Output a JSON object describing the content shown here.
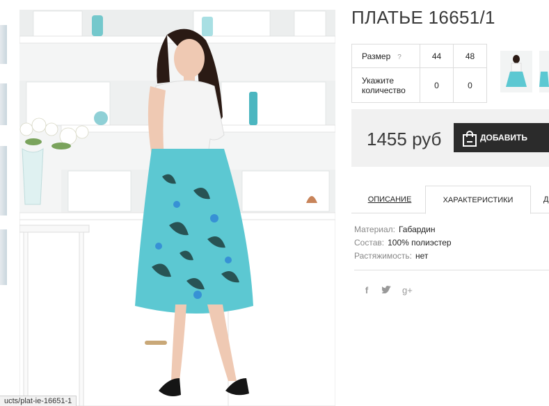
{
  "product": {
    "title": "ПЛАТЬЕ 16651/1",
    "price": "1455 руб",
    "add_button_label": "ДОБАВИТЬ"
  },
  "size_table": {
    "size_label": "Размер",
    "help_symbol": "?",
    "qty_label": "Укажите количество",
    "sizes": [
      "44",
      "48"
    ],
    "quantities": [
      "0",
      "0"
    ]
  },
  "tabs": [
    {
      "label": "ОПИСАНИЕ",
      "active": false
    },
    {
      "label": "ХАРАКТЕРИСТИКИ",
      "active": true
    },
    {
      "label": "Д",
      "active": false
    }
  ],
  "characteristics": [
    {
      "key": "Материал:",
      "value": "Габардин"
    },
    {
      "key": "Состав:",
      "value": "100% полиэстер"
    },
    {
      "key": "Растяжимость:",
      "value": "нет"
    }
  ],
  "social": {
    "facebook": "f",
    "twitter": "t",
    "googleplus": "g+"
  },
  "status_bar": {
    "url": "ucts/plat-ie-16651-1"
  },
  "colors": {
    "accent_dark": "#2b2b2b",
    "price_bg": "#f1f1f1",
    "skirt_turquoise": "#5cc8d2"
  }
}
